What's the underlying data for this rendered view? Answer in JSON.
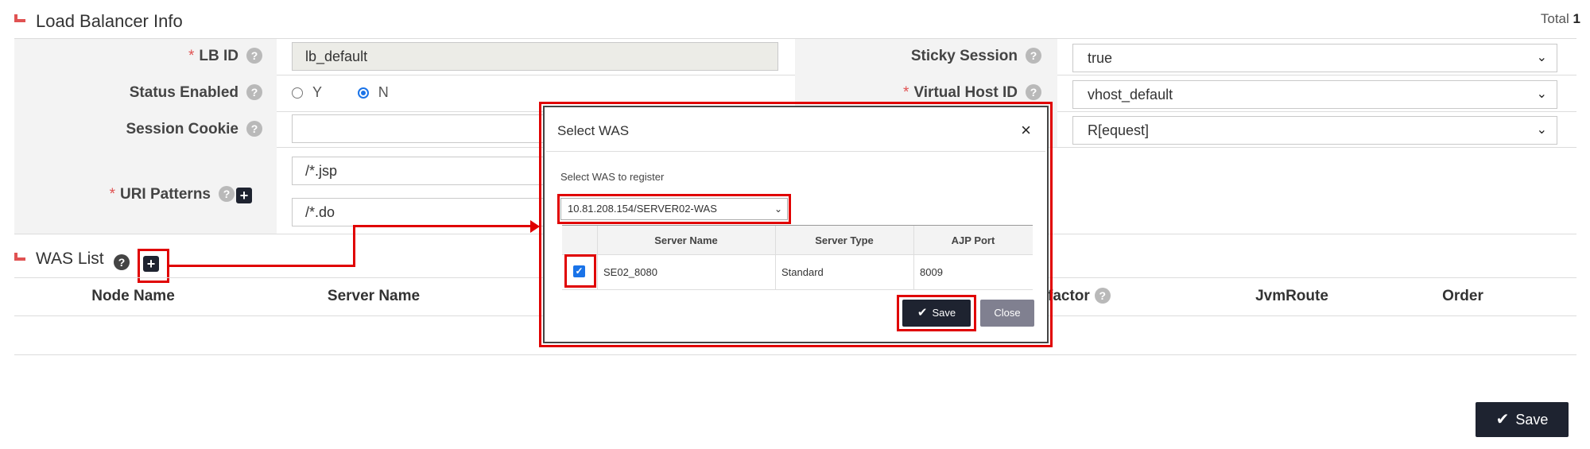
{
  "lb_section": {
    "title": "Load Balancer Info",
    "total_label": "Total",
    "total_value": "1"
  },
  "form": {
    "lb_id": {
      "label": "LB ID",
      "required_mark": "*",
      "value": "lb_default"
    },
    "status_enabled": {
      "label": "Status Enabled",
      "option_y": "Y",
      "option_n": "N",
      "selected": "N"
    },
    "session_cookie": {
      "label": "Session Cookie",
      "value": ""
    },
    "uri_patterns": {
      "label": "URI Patterns",
      "required_mark": "*",
      "values": [
        "/*.jsp",
        "/*.do"
      ]
    },
    "sticky_session": {
      "label": "Sticky Session",
      "value": "true"
    },
    "virtual_host_id": {
      "label": "Virtual Host ID",
      "required_mark": "*",
      "value": "vhost_default"
    },
    "third_select": {
      "value": "R[equest]"
    }
  },
  "help_icon": "?",
  "plus_icon": "+",
  "was_section": {
    "title": "WAS List",
    "columns": [
      "Node Name",
      "Server Name",
      "factor",
      "JvmRoute",
      "Order"
    ]
  },
  "modal": {
    "title": "Select WAS",
    "close_icon": "×",
    "subtitle": "Select WAS to register",
    "select_value": "10.81.208.154/SERVER02-WAS",
    "columns": [
      "Server Name",
      "Server Type",
      "AJP Port"
    ],
    "rows": [
      {
        "checked": true,
        "server_name": "SE02_8080",
        "server_type": "Standard",
        "ajp_port": "8009"
      }
    ],
    "save_label": "Save",
    "close_label": "Close"
  },
  "footer": {
    "save_label": "Save"
  },
  "colors": {
    "accent_red": "#e00000",
    "dark_button": "#1e2330",
    "checkbox_blue": "#1a73e8"
  }
}
